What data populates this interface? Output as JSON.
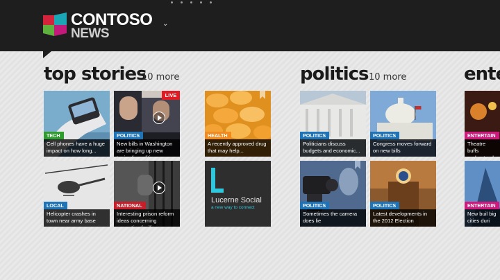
{
  "app": {
    "logo_title": "CONTOSO",
    "logo_subtitle": "NEWS",
    "colors": {
      "header_bg": "#1e1e1e",
      "logo_red": "#d4233a",
      "logo_teal": "#1ba6b5",
      "logo_green": "#5db13c",
      "logo_magenta": "#c3197b"
    }
  },
  "sections": [
    {
      "title": "top stories",
      "more_label": "10 more",
      "tiles": [
        {
          "tag": "TECH",
          "tag_color": "#2e9d2e",
          "caption": "Cell phones have a huge impact on how long...",
          "video": false,
          "live": false
        },
        {
          "tag": "POLITICS",
          "tag_color": "#1f74b7",
          "caption": "New bills in Washington are bringing up new topics for politi...",
          "video": true,
          "live": true,
          "live_label": "LIVE"
        },
        {
          "tag": "HEALTH",
          "tag_color": "#f28b1c",
          "caption": "A recently approved drug that may help...",
          "video": false,
          "bookmark": true
        },
        {
          "tag": "LOCAL",
          "tag_color": "#1f74b7",
          "caption": "Helicopter crashes in town near army base",
          "video": false
        },
        {
          "tag": "NATIONAL",
          "tag_color": "#c41f2a",
          "caption": "Interesting prison reform ideas concerning correction facili...",
          "video": true
        },
        {
          "social": true,
          "name": "Lucerne Social",
          "tagline": "a new way to connect"
        }
      ]
    },
    {
      "title": "politics",
      "more_label": "10 more",
      "tiles": [
        {
          "tag": "POLITICS",
          "tag_color": "#1f74b7",
          "caption": "Politicians discuss budgets and economic..."
        },
        {
          "tag": "POLITICS",
          "tag_color": "#1f74b7",
          "caption": "Congress moves forward on new bills"
        },
        {
          "tag": "POLITICS",
          "tag_color": "#1f74b7",
          "caption": "Sometimes the camera does lie",
          "bookmark": true
        },
        {
          "tag": "POLITICS",
          "tag_color": "#1f74b7",
          "caption": "Latest developments in the 2012 Election"
        }
      ]
    },
    {
      "title": "ente",
      "tiles": [
        {
          "tag": "ENTERTAIN",
          "tag_color": "#d0197c",
          "caption": "Theatre buffs understand th"
        },
        {
          "tag": "ENTERTAIN",
          "tag_color": "#d0197c",
          "caption": "New buil big cities duri"
        }
      ]
    }
  ]
}
